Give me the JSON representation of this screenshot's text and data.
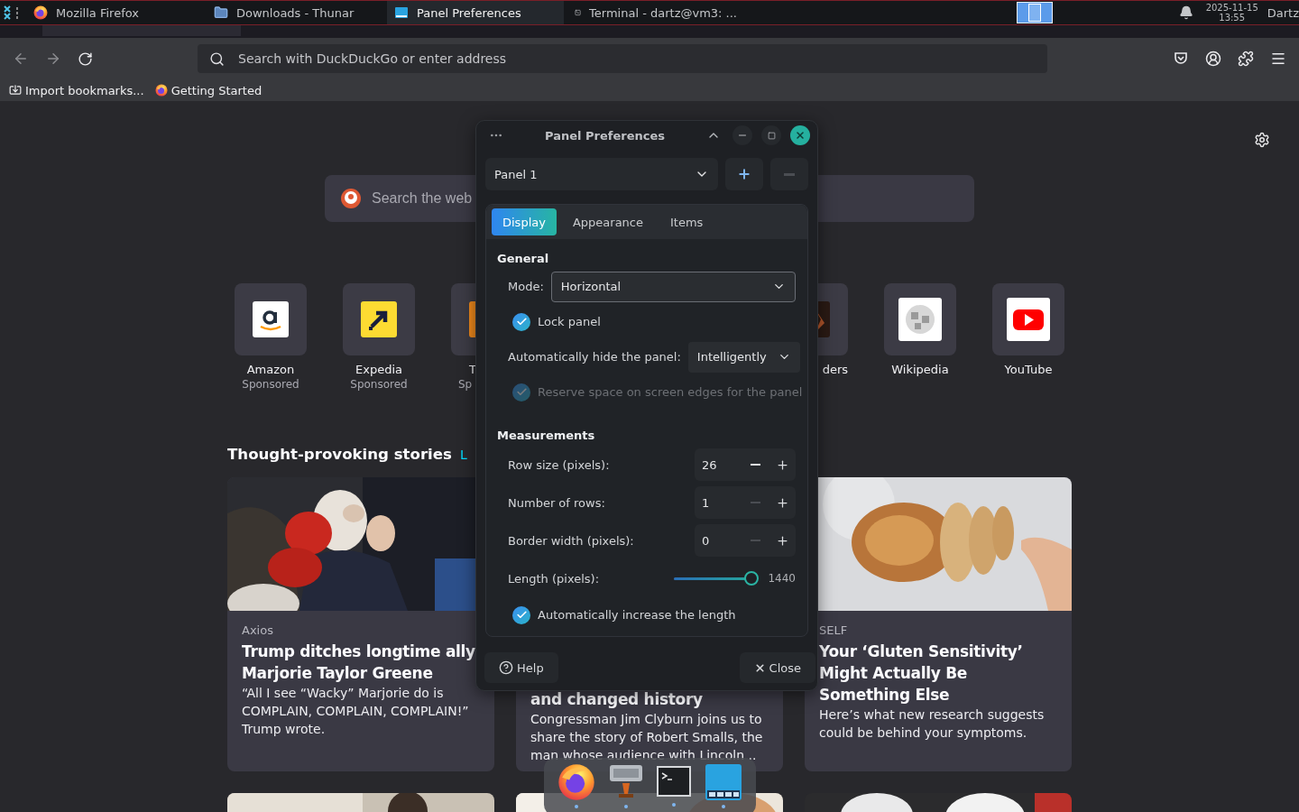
{
  "top_panel": {
    "windows": [
      {
        "title": "Mozilla Firefox",
        "selected": false
      },
      {
        "title": "Downloads - Thunar",
        "selected": false
      },
      {
        "title": "Panel Preferences",
        "selected": true
      },
      {
        "title": "Terminal - dartz@vm3: ...",
        "selected": false
      }
    ],
    "clock": {
      "date": "2025-11-15",
      "time": "13:55"
    },
    "user": "Dartz"
  },
  "browser": {
    "address_bar": {
      "placeholder": "Search with DuckDuckGo or enter address"
    },
    "bookmarks": [
      {
        "label": "Import bookmarks..."
      },
      {
        "label": "Getting Started"
      }
    ]
  },
  "new_tab": {
    "search": {
      "placeholder": "Search the web"
    },
    "shortcuts": [
      {
        "kind": "whole",
        "label": "Amazon",
        "sponsor": "Sponsored"
      },
      {
        "kind": "whole",
        "label": "Expedia",
        "sponsor": "Sponsored"
      },
      {
        "kind": "cut_right",
        "label": "T",
        "sponsor": "Sp"
      },
      {
        "kind": "cut_left",
        "label": "ders"
      },
      {
        "kind": "whole",
        "label": "Wikipedia"
      },
      {
        "kind": "whole",
        "label": "YouTube"
      }
    ],
    "stories": {
      "heading": "Thought-provoking stories",
      "link": "L",
      "cards": [
        {
          "kind": "full",
          "source": "Axios",
          "title": "Trump ditches longtime ally Marjorie Taylor Greene",
          "excerpt": "“All I see “Wacky” Marjorie do is COMPLAIN, COMPLAIN, COMPLAIN!” Trump wrote."
        },
        {
          "kind": "covered",
          "title": "and changed history",
          "excerpt": "Congressman Jim Clyburn joins us to share the story of Robert Smalls, the man whose audience with Lincoln .."
        },
        {
          "kind": "full",
          "source": "SELF",
          "title": "Your ‘Gluten Sensitivity’ Might Actually Be Something Else",
          "excerpt": "Here’s what new research suggests could be behind your symptoms."
        }
      ]
    }
  },
  "dialog": {
    "title": "Panel Preferences",
    "panel": {
      "value": "Panel 1",
      "remove_disabled": true
    },
    "tabs": [
      {
        "label": "Display",
        "selected": true
      },
      {
        "label": "Appearance",
        "selected": false
      },
      {
        "label": "Items",
        "selected": false
      }
    ],
    "general": {
      "heading": "General",
      "options": [
        {
          "kind": "combo",
          "label": "Mode:",
          "value": "Horizontal"
        },
        {
          "kind": "check",
          "label": "Lock panel",
          "checked": true,
          "disabled": false
        },
        {
          "kind": "select",
          "label": "Automatically hide the panel:",
          "value": "Intelligently"
        },
        {
          "kind": "check",
          "label": "Reserve space on screen edges for the panel",
          "checked": true,
          "disabled": true
        }
      ]
    },
    "measurements": {
      "heading": "Measurements",
      "rows": [
        {
          "kind": "spin",
          "label": "Row size (pixels):",
          "value": "26",
          "minus_disabled": false
        },
        {
          "kind": "spin",
          "label": "Number of rows:",
          "value": "1",
          "minus_disabled": true
        },
        {
          "kind": "spin",
          "label": "Border width (pixels):",
          "value": "0",
          "minus_disabled": true
        },
        {
          "kind": "slider",
          "label": "Length (pixels):",
          "level": 1,
          "reading": "1440"
        },
        {
          "kind": "check",
          "label": "Automatically increase the length",
          "checked": true,
          "disabled": false
        }
      ]
    },
    "buttons": [
      {
        "kind": "help",
        "label": "Help"
      },
      {
        "kind": "close",
        "label": "Close"
      }
    ]
  },
  "dock": {
    "apps": [
      {
        "running": true
      },
      {
        "running": true
      },
      {
        "running": true
      },
      {
        "running": true
      }
    ]
  }
}
